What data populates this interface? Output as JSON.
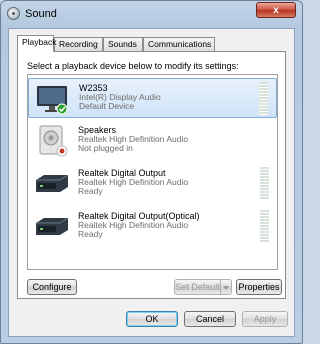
{
  "window": {
    "title": "Sound",
    "close_glyph": "x"
  },
  "tabs": [
    {
      "label": "Playback"
    },
    {
      "label": "Recording"
    },
    {
      "label": "Sounds"
    },
    {
      "label": "Communications"
    }
  ],
  "instruction": "Select a playback device below to modify its settings:",
  "devices": [
    {
      "name": "W2353",
      "description": "Intel(R) Display Audio",
      "status": "Default Device",
      "icon": "monitor-icon"
    },
    {
      "name": "Speakers",
      "description": "Realtek High Definition Audio",
      "status": "Not plugged in",
      "icon": "speaker-icon"
    },
    {
      "name": "Realtek Digital Output",
      "description": "Realtek High Definition Audio",
      "status": "Ready",
      "icon": "digital-output-icon"
    },
    {
      "name": "Realtek Digital Output(Optical)",
      "description": "Realtek High Definition Audio",
      "status": "Ready",
      "icon": "optical-output-icon"
    }
  ],
  "buttons": {
    "configure": "Configure",
    "set_default": "Set Default",
    "properties": "Properties",
    "ok": "OK",
    "cancel": "Cancel",
    "apply": "Apply"
  },
  "colors": {
    "accent": "#84acdd",
    "default_check": "#2aa02a",
    "unplugged": "#c0392b"
  }
}
